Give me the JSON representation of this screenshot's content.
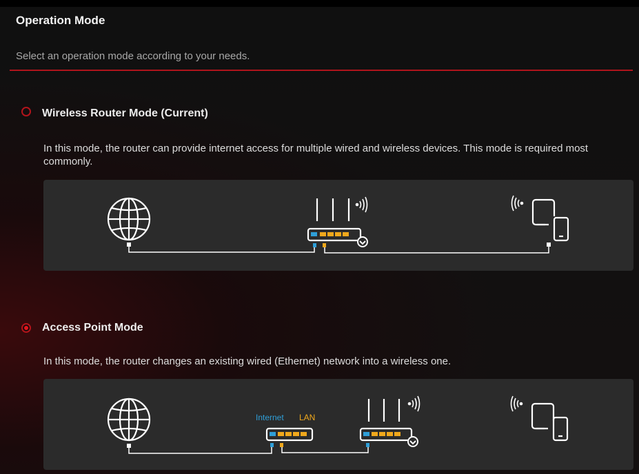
{
  "page": {
    "title": "Operation Mode",
    "subtitle": "Select an operation mode according to your needs."
  },
  "modes": [
    {
      "label": "Wireless Router Mode (Current)",
      "selected": false,
      "description": "In this mode, the router can provide internet access for multiple wired and wireless devices. This mode is required most commonly."
    },
    {
      "label": "Access Point Mode",
      "selected": true,
      "description": "In this mode, the router changes an existing wired (Ethernet) network into a wireless one."
    }
  ],
  "diagram_ap": {
    "internet_label": "Internet",
    "lan_label": "LAN"
  },
  "colors": {
    "accent": "#b3141b",
    "wan_port": "#2f9fd8",
    "lan_port": "#f0a81c",
    "panel_bg": "#2b2b2b"
  },
  "icons": [
    "globe-icon",
    "router-icon",
    "wifi-signal-icon",
    "devices-icon",
    "modem-icon"
  ]
}
